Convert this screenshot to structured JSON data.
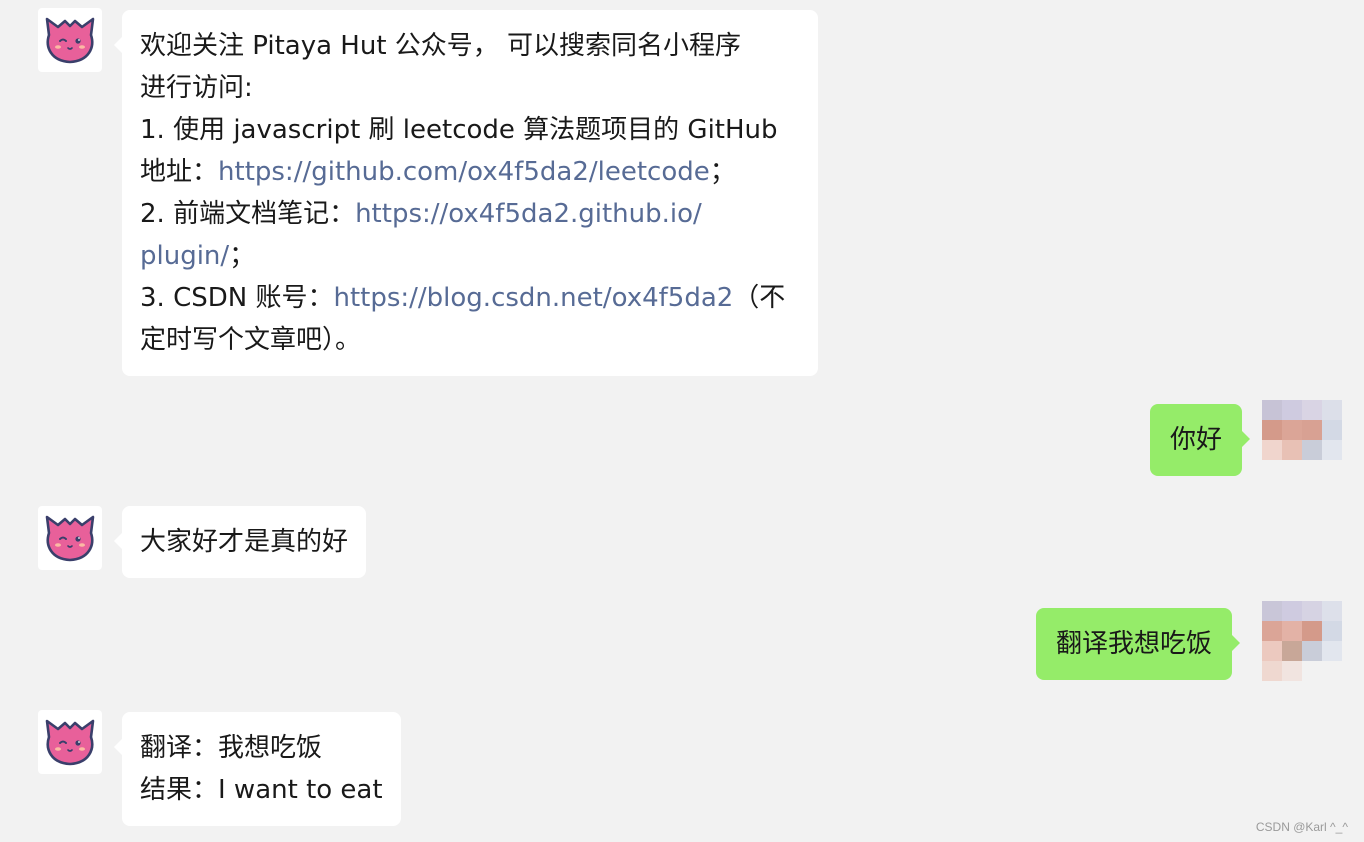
{
  "conversation": {
    "messages": [
      {
        "sender": "bot",
        "avatar_icon": "pitaya-mascot-icon",
        "lines": [
          [
            "欢迎关注 Pitaya Hut 公众号， 可以搜索同名小程序"
          ],
          [
            "进行访问:"
          ],
          [
            "1. 使用 javascript 刷 leetcode 算法题项目的 GitHub"
          ],
          [
            "地址：",
            "https://github.com/ox4f5da2/leetcode",
            "；"
          ],
          [
            "2. 前端文档笔记：",
            "https://ox4f5da2.github.io/"
          ],
          [
            "",
            "plugin/",
            "；"
          ],
          [
            "3. CSDN 账号：",
            "https://blog.csdn.net/ox4f5da2",
            "（不"
          ],
          [
            "定时写个文章吧）。"
          ]
        ]
      },
      {
        "sender": "user",
        "avatar_icon": "pixelated-avatar-icon",
        "text": "你好"
      },
      {
        "sender": "bot",
        "avatar_icon": "pitaya-mascot-icon",
        "text": "大家好才是真的好"
      },
      {
        "sender": "user",
        "avatar_icon": "pixelated-avatar-icon",
        "text": "翻译我想吃饭"
      },
      {
        "sender": "bot",
        "avatar_icon": "pitaya-mascot-icon",
        "lines": [
          [
            "翻译：我想吃饭"
          ],
          [
            "结果：I want to eat"
          ]
        ]
      }
    ]
  },
  "watermark": "CSDN @Karl ^_^",
  "colors": {
    "background": "#f2f2f2",
    "bot_bubble": "#ffffff",
    "user_bubble": "#95ec69",
    "link": "#576b95",
    "mascot_pink": "#e8609a",
    "mascot_outline": "#3a3f6b"
  }
}
